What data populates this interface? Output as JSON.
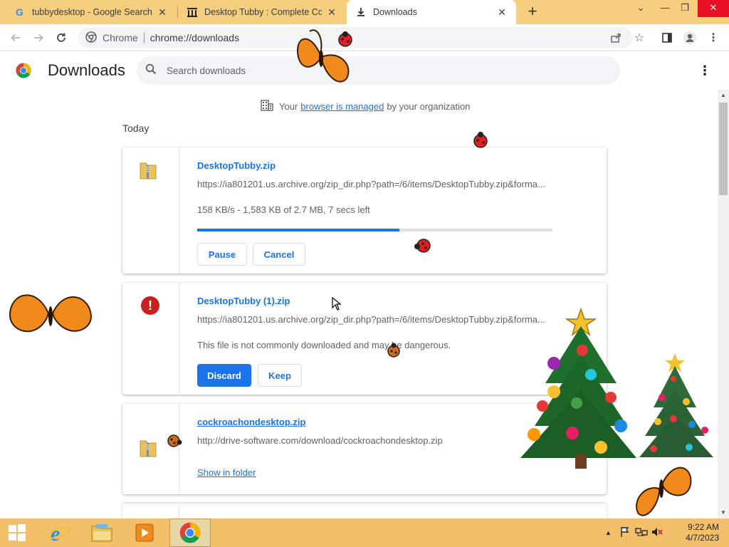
{
  "tabs": [
    {
      "title": "tubbydesktop - Google Search",
      "favicon": "google-g-icon"
    },
    {
      "title": "Desktop Tubby : Complete Contents",
      "favicon": "archive-org-icon"
    },
    {
      "title": "Downloads",
      "favicon": "download-icon",
      "active": true
    }
  ],
  "omnibox": {
    "site_label": "Chrome",
    "url": "chrome://downloads"
  },
  "page": {
    "title": "Downloads",
    "search_placeholder": "Search downloads",
    "managed_prefix": "Your",
    "managed_link": "browser is managed",
    "managed_suffix": "by your organization",
    "section_label": "Today"
  },
  "downloads": [
    {
      "filename": "DesktopTubby.zip",
      "url": "https://ia801201.us.archive.org/zip_dir.php?path=/6/items/DesktopTubby.zip&forma...",
      "status": "158 KB/s - 1,583 KB of 2.7 MB, 7 secs left",
      "progress": 0.57,
      "buttons": [
        "Pause",
        "Cancel"
      ]
    },
    {
      "filename": "DesktopTubby (1).zip",
      "url": "https://ia801201.us.archive.org/zip_dir.php?path=/6/items/DesktopTubby.zip&forma...",
      "status": "This file is not commonly downloaded and may be dangerous.",
      "buttons": [
        "Discard",
        "Keep"
      ]
    },
    {
      "filename": "cockroachondesktop.zip",
      "url": "http://drive-software.com/download/cockroachondesktop.zip",
      "link": "Show in folder"
    }
  ],
  "taskbar": {
    "apps": [
      "start-button",
      "internet-explorer-icon",
      "file-explorer-icon",
      "media-player-icon",
      "chrome-icon"
    ],
    "time": "9:22 AM",
    "date": "4/7/2023"
  },
  "colors": {
    "tabstrip": "#f5cf7d",
    "accent": "#1a73e8",
    "danger": "#c5221f",
    "taskbar": "#f2c06a"
  }
}
